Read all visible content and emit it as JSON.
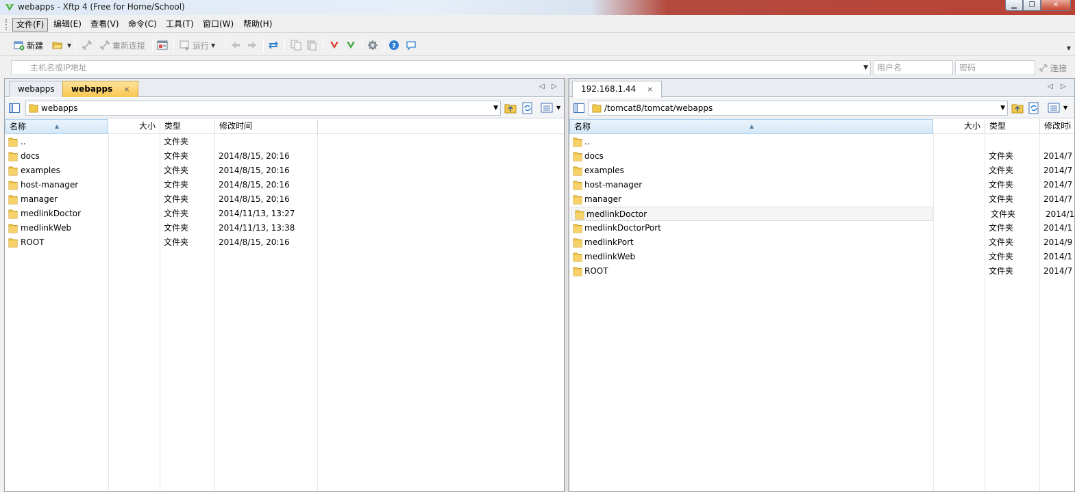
{
  "window": {
    "title": "webapps - Xftp 4 (Free for Home/School)",
    "buttons": [
      "▁",
      "❐",
      "✕"
    ]
  },
  "menu": [
    "文件(F)",
    "编辑(E)",
    "查看(V)",
    "命令(C)",
    "工具(T)",
    "窗口(W)",
    "帮助(H)"
  ],
  "toolbar": {
    "new_label": "新建",
    "reconnect_label": "重新连接",
    "run_label": "运行"
  },
  "address": {
    "host_placeholder": "主机名或IP地址",
    "user_placeholder": "用户名",
    "password_placeholder": "密码",
    "connect_label": "连接"
  },
  "local": {
    "tabs": [
      "webapps",
      "webapps"
    ],
    "tab_close": "×",
    "path": "webapps",
    "columns": [
      "名称",
      "大小",
      "类型",
      "修改时间"
    ],
    "rows": [
      {
        "name": "..",
        "size": "",
        "type": "文件夹",
        "modified": ""
      },
      {
        "name": "docs",
        "size": "",
        "type": "文件夹",
        "modified": "2014/8/15, 20:16"
      },
      {
        "name": "examples",
        "size": "",
        "type": "文件夹",
        "modified": "2014/8/15, 20:16"
      },
      {
        "name": "host-manager",
        "size": "",
        "type": "文件夹",
        "modified": "2014/8/15, 20:16"
      },
      {
        "name": "manager",
        "size": "",
        "type": "文件夹",
        "modified": "2014/8/15, 20:16"
      },
      {
        "name": "medlinkDoctor",
        "size": "",
        "type": "文件夹",
        "modified": "2014/11/13, 13:27"
      },
      {
        "name": "medlinkWeb",
        "size": "",
        "type": "文件夹",
        "modified": "2014/11/13, 13:38"
      },
      {
        "name": "ROOT",
        "size": "",
        "type": "文件夹",
        "modified": "2014/8/15, 20:16"
      }
    ]
  },
  "remote": {
    "tabs": [
      "192.168.1.44"
    ],
    "tab_close": "×",
    "path": "/tomcat8/tomcat/webapps",
    "columns": [
      "名称",
      "大小",
      "类型",
      "修改时i"
    ],
    "rows": [
      {
        "name": "..",
        "size": "",
        "type": "",
        "modified": ""
      },
      {
        "name": "docs",
        "size": "",
        "type": "文件夹",
        "modified": "2014/7"
      },
      {
        "name": "examples",
        "size": "",
        "type": "文件夹",
        "modified": "2014/7"
      },
      {
        "name": "host-manager",
        "size": "",
        "type": "文件夹",
        "modified": "2014/7"
      },
      {
        "name": "manager",
        "size": "",
        "type": "文件夹",
        "modified": "2014/7"
      },
      {
        "name": "medlinkDoctor",
        "size": "",
        "type": "文件夹",
        "modified": "2014/1"
      },
      {
        "name": "medlinkDoctorPort",
        "size": "",
        "type": "文件夹",
        "modified": "2014/1"
      },
      {
        "name": "medlinkPort",
        "size": "",
        "type": "文件夹",
        "modified": "2014/9"
      },
      {
        "name": "medlinkWeb",
        "size": "",
        "type": "文件夹",
        "modified": "2014/1"
      },
      {
        "name": "ROOT",
        "size": "",
        "type": "文件夹",
        "modified": "2014/7"
      }
    ],
    "hover_row": 5
  },
  "colors": {
    "folder": "#f2c94c",
    "active_tab": "#f9c64f",
    "selection_header": "#d4e8f7"
  }
}
